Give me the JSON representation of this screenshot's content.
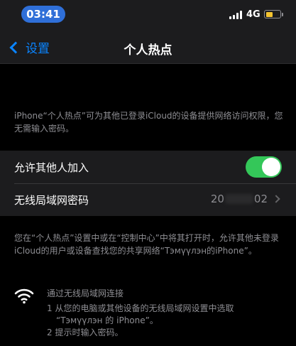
{
  "status_bar": {
    "time": "03:41",
    "network": "4G",
    "battery_level": 0.5,
    "battery_color": "#f4c430"
  },
  "nav": {
    "back_label": "设置",
    "title": "个人热点"
  },
  "description": "iPhone“个人热点”可为其他已登录iCloud的设备提供网络访问权限，您无需输入密码。",
  "settings": {
    "allow_others_label": "允许其他人加入",
    "allow_others_enabled": true,
    "password_label": "无线局域网密码",
    "password_prefix": "20",
    "password_suffix": "02"
  },
  "note": "您在“个人热点”设置中或在“控制中心”中将其打开时，允许其他未登录iCloud的用户或设备查找您的共享网络“Тэмүүлэн的iPhone”。",
  "wifi": {
    "icon": "wifi-icon",
    "title": "通过无线局域网连接",
    "step1_line1": "1 从您的电脑或其他设备的无线局域网设置中选取",
    "step1_line2": "“Тэмүүлэн 的 iPhone”。",
    "step2": "2 提示时输入密码。"
  },
  "colors": {
    "accent": "#0a84ff",
    "toggle_on": "#34c759",
    "time_pill": "#2f6fd8"
  }
}
